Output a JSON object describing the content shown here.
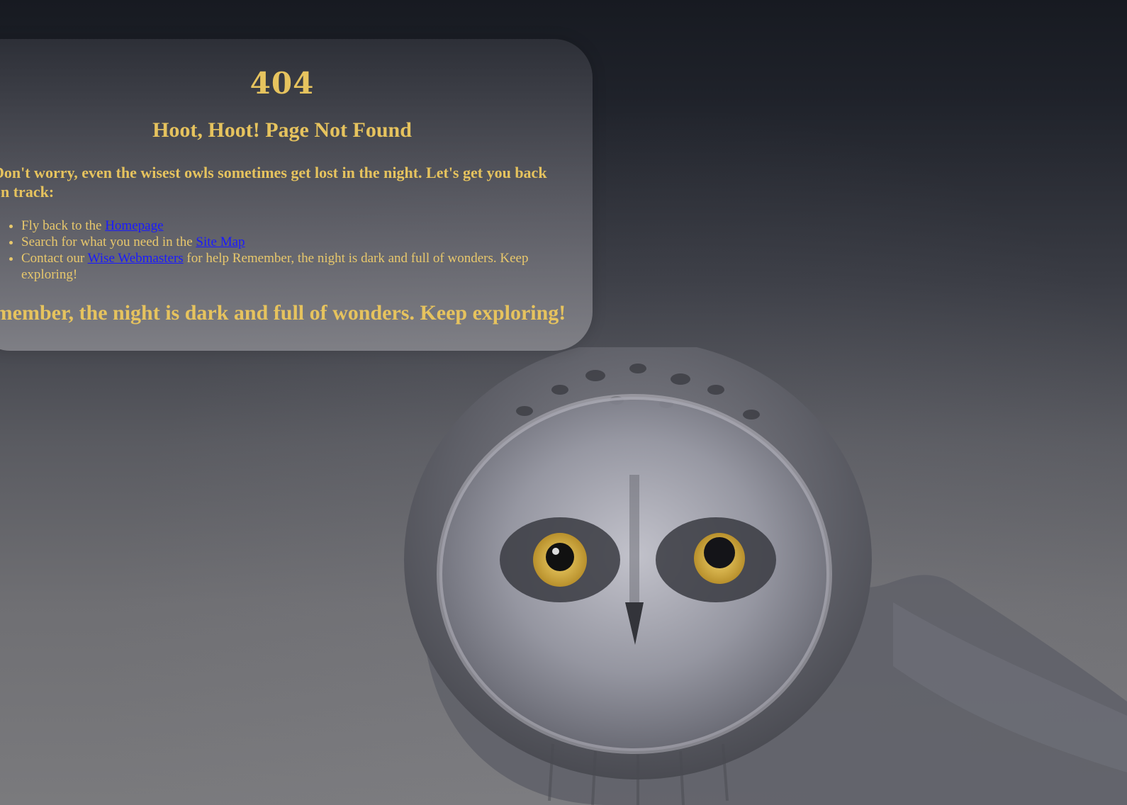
{
  "error": {
    "code": "404",
    "title": "Hoot, Hoot! Page Not Found",
    "intro": "Don't worry, even the wisest owls sometimes get lost in the night. Let's get you back on track:",
    "links": [
      {
        "prefix": "Fly back to the ",
        "link_text": "Homepage",
        "suffix": ""
      },
      {
        "prefix": "Search for what you need in the ",
        "link_text": "Site Map",
        "suffix": ""
      },
      {
        "prefix": "Contact our ",
        "link_text": "Wise Webmasters",
        "suffix": " for help Remember, the night is dark and full of wonders. Keep exploring!"
      }
    ],
    "closing": "Remember, the night is dark and full of wonders. Keep exploring!"
  },
  "background": {
    "image": "owl-photo",
    "accent_color": "#e6c35e",
    "link_color": "#1a1aff"
  }
}
